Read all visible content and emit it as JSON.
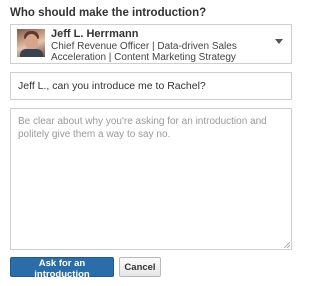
{
  "dialog": {
    "heading": "Who should make the introduction?"
  },
  "introducer": {
    "name": "Jeff L. Herrmann",
    "title": "Chief Revenue Officer | Data-driven Sales Acceleration | Content Marketing Strategy",
    "avatar_icon": "profile-photo",
    "dropdown_icon": "caret-down-icon"
  },
  "subject": {
    "value": "Jeff L., can you introduce me to Rachel?"
  },
  "message": {
    "value": "",
    "placeholder": "Be clear about why you're asking for an introduction and politely give them a way to say no."
  },
  "actions": {
    "primary_label": "Ask for an introduction",
    "cancel_label": "Cancel"
  },
  "colors": {
    "primary_button": "#2b6da8",
    "border": "#cfcfcf",
    "placeholder_text": "#9a9a9a"
  }
}
